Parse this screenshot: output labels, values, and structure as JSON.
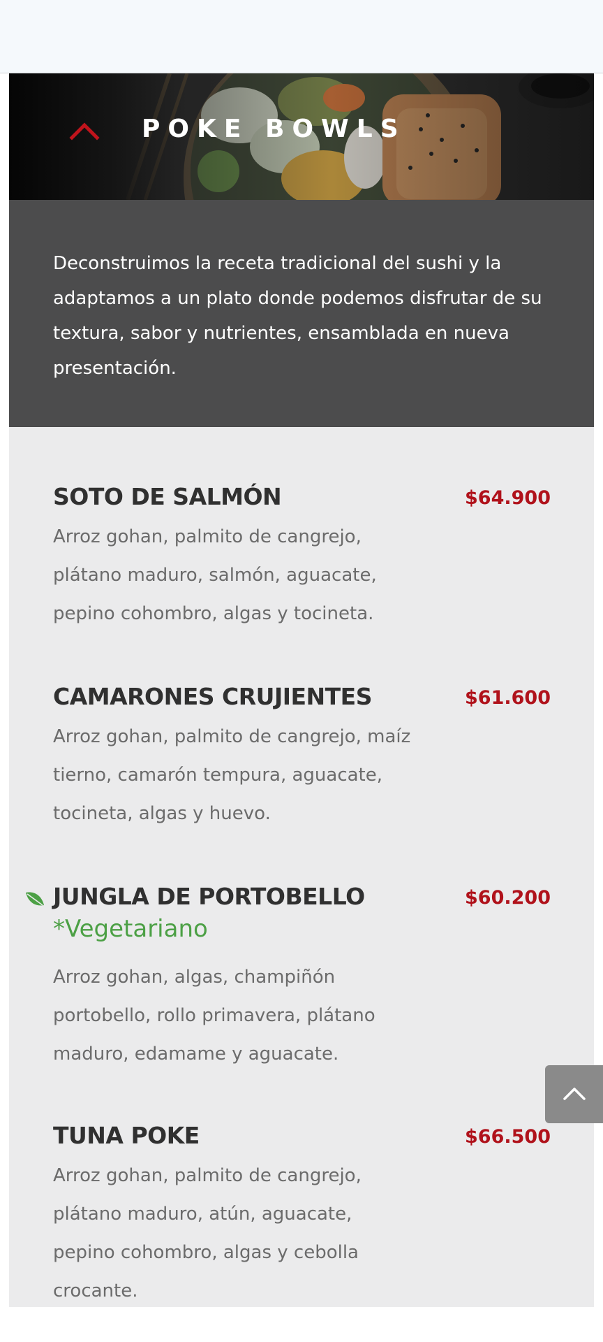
{
  "section": {
    "title": "POKE BOWLS",
    "description": "Deconstruimos la receta tradicional del sushi y la adaptamos a un plato donde podemos disfrutar de su textura, sabor y nutrientes, ensamblada en nueva presentación."
  },
  "menu_items": [
    {
      "name": "SOTO DE SALMÓN",
      "price": "$64.900",
      "description": "Arroz gohan, palmito de cangrejo, plátano maduro, salmón, aguacate, pepino cohombro, algas y tocineta."
    },
    {
      "name": "CAMARONES CRUJIENTES",
      "price": "$61.600",
      "description": "Arroz gohan, palmito de cangrejo, maíz tierno, camarón tempura, aguacate, tocineta, algas y huevo."
    },
    {
      "name": "JUNGLA DE PORTOBELLO",
      "tag": "*Vegetariano",
      "icon": "leaf-icon",
      "price": "$60.200",
      "description": "Arroz gohan, algas, champiñón portobello, rollo primavera, plátano maduro, edamame y aguacate."
    },
    {
      "name": "TUNA POKE",
      "price": "$66.500",
      "description": "Arroz gohan, palmito de cangrejo, plátano maduro, atún, aguacate, pepino cohombro, algas y cebolla crocante."
    }
  ],
  "icons": {
    "collapse": "chevron-up-icon",
    "scroll_top": "chevron-up-icon",
    "vegetarian": "leaf-icon"
  },
  "colors": {
    "price": "#b0121b",
    "vegetarian": "#4ca045",
    "intro_bg": "#4c4c4d",
    "list_bg": "#ebebec",
    "scroll_button": "#8a8a8a"
  }
}
